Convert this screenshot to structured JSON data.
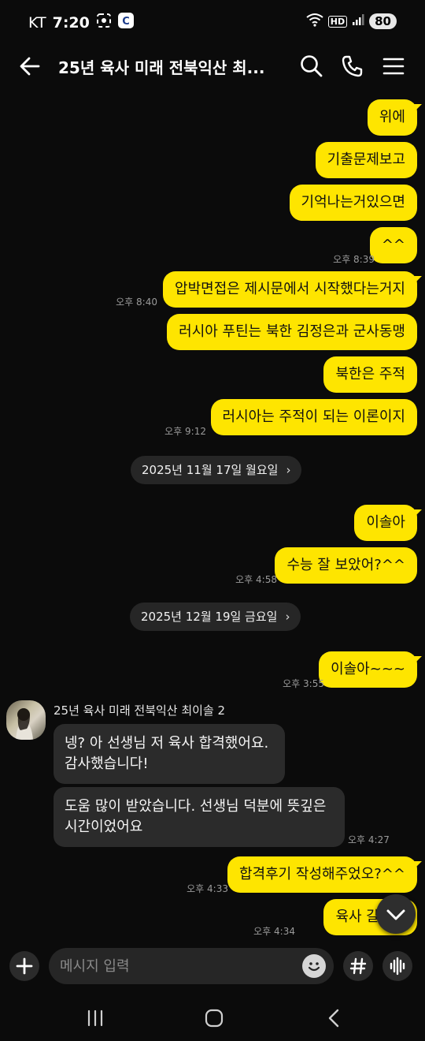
{
  "status_bar": {
    "carrier": "KT",
    "time": "7:20",
    "battery": "80",
    "hd_label": "HD"
  },
  "header": {
    "title": "25년 육사 미래 전북익산 최..."
  },
  "messages_sent_1": [
    {
      "text": "위에"
    },
    {
      "text": "기출문제보고"
    },
    {
      "text": "기억나는거있으면"
    },
    {
      "text": "^^",
      "time": "오후 8:39"
    },
    {
      "text": "압박면접은 제시문에서 시작했다는거지",
      "time": "오후 8:40"
    },
    {
      "text": "러시아 푸틴는 북한 김정은과 군사동맹"
    },
    {
      "text": "북한은 주적"
    },
    {
      "text": "러시아는 주적이 되는 이론이지",
      "time": "오후 9:12"
    }
  ],
  "date_1": "2025년 11월 17일 월요일",
  "messages_sent_2": [
    {
      "text": "이솔아"
    },
    {
      "text": "수능 잘 보았어?^^",
      "time": "오후 4:58"
    }
  ],
  "date_2": "2025년 12월 19일 금요일",
  "messages_sent_3": [
    {
      "text": "이솔아~~~",
      "time": "오후 3:55"
    }
  ],
  "received": {
    "sender": "25년 육사 미래 전북익산 최이솔 2",
    "messages": [
      {
        "line1": "넹? 아 선생님 저 육사 합격했어요.",
        "line2": "감사했습니다!"
      },
      {
        "line1": "도움 많이 받았습니다. 선생님 덕분에 뜻깊은",
        "line2": "시간이었어요",
        "time": "오후 4:27"
      }
    ]
  },
  "messages_sent_4": [
    {
      "text": "합격후기 작성해주었오?^^",
      "time": "오후 4:33"
    },
    {
      "text": "육사 갈거지",
      "time": "오후 4:34"
    }
  ],
  "input": {
    "placeholder": "메시지 입력"
  },
  "colors": {
    "my_bubble": "#fee500",
    "their_bubble": "#2b2b2b",
    "background": "#0b0b0b"
  }
}
